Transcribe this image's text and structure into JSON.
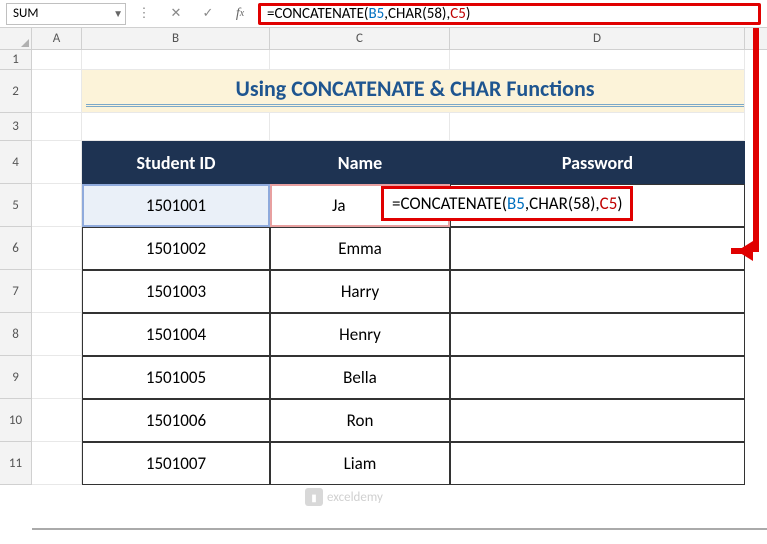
{
  "namebox": "SUM",
  "formula": {
    "eq": "=",
    "fn": "CONCATENATE(",
    "a1": "B5",
    "c1": ",",
    "mid": "CHAR(58)",
    "c2": ",",
    "a2": "C5",
    "close": ")"
  },
  "columns": {
    "A": "A",
    "B": "B",
    "C": "C",
    "D": "D"
  },
  "rowNums": [
    "1",
    "2",
    "3",
    "4",
    "5",
    "6",
    "7",
    "8",
    "9",
    "10",
    "11"
  ],
  "title": "Using CONCATENATE & CHAR Functions",
  "headers": {
    "id": "Student ID",
    "name": "Name",
    "pw": "Password"
  },
  "data": [
    {
      "id": "1501001",
      "name": "Ja",
      "pw": ""
    },
    {
      "id": "1501002",
      "name": "Emma",
      "pw": ""
    },
    {
      "id": "1501003",
      "name": "Harry",
      "pw": ""
    },
    {
      "id": "1501004",
      "name": "Henry",
      "pw": ""
    },
    {
      "id": "1501005",
      "name": "Bella",
      "pw": ""
    },
    {
      "id": "1501006",
      "name": "Ron",
      "pw": ""
    },
    {
      "id": "1501007",
      "name": "Liam",
      "pw": ""
    }
  ],
  "watermark": "exceldemy"
}
